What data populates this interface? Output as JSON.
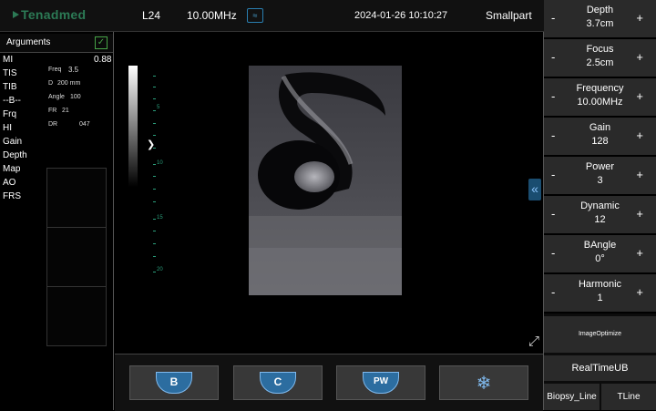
{
  "header": {
    "logo": "Tenadmed",
    "probe": "L24",
    "frequency": "10.00MHz",
    "datetime": "2024-01-26 10:10:27",
    "mode": "Smallpart"
  },
  "arguments": {
    "title": "Arguments",
    "items": [
      "MI",
      "TIS",
      "TIB",
      "--B--",
      "Frq",
      "HI",
      "Gain",
      "Depth",
      "Map",
      "AO",
      "FRS"
    ],
    "mi_value": "0.88"
  },
  "params": {
    "freq_label": "Freq",
    "freq_value": "3.5",
    "d_label": "D",
    "d_value": "200 mm",
    "angle_label": "Angle",
    "angle_value": "100",
    "fr_label": "FR",
    "fr_value": "21",
    "dr_label": "DR",
    "dr_value": "047"
  },
  "ruler": {
    "labels": [
      "5",
      "10",
      "15",
      "20"
    ]
  },
  "controls": [
    {
      "name": "Depth",
      "value": "3.7cm"
    },
    {
      "name": "Focus",
      "value": "2.5cm"
    },
    {
      "name": "Frequency",
      "value": "10.00MHz"
    },
    {
      "name": "Gain",
      "value": "128"
    },
    {
      "name": "Power",
      "value": "3"
    },
    {
      "name": "Dynamic",
      "value": "12"
    },
    {
      "name": "BAngle",
      "value": "0°"
    },
    {
      "name": "Harmonic",
      "value": "1"
    }
  ],
  "minus_label": "-",
  "plus_label": "+",
  "buttons": {
    "image_optimize": "ImageOptimize",
    "realtime_ub": "RealTimeUB",
    "biopsy_line": "Biopsy_Line",
    "tline": "TLine"
  },
  "modes": {
    "b": "B",
    "c": "C",
    "pw": "PW"
  },
  "colors": {
    "accent": "#2c6da0",
    "ruler": "#2a9d7a",
    "logo": "#2c7a55"
  }
}
